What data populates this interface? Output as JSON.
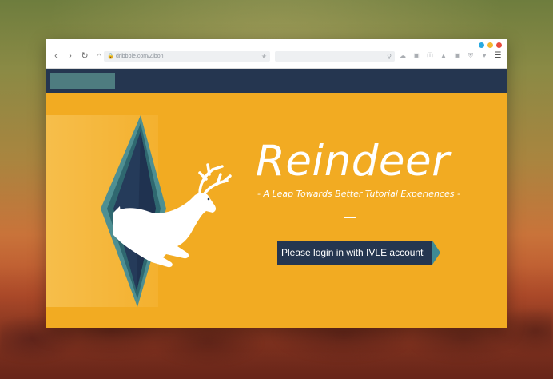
{
  "browser": {
    "url": "dribbble.com/Zibon",
    "nav": {
      "back_icon": "‹",
      "forward_icon": "›",
      "reload_icon": "↻",
      "home_icon": "⌂"
    },
    "window_dots": [
      "#29a9e0",
      "#f5b82e",
      "#e84b3c"
    ],
    "toolbar_icons": [
      "cloud-icon",
      "camera-icon",
      "info-icon",
      "extension-icon",
      "screenshot-icon",
      "shield-icon",
      "heart-icon",
      "menu-icon"
    ]
  },
  "site": {
    "header_color": "#253650",
    "logo_color": "#4e7c80"
  },
  "hero": {
    "title": "Reindeer",
    "subtitle": "- A Leap Towards Better Tutorial Experiences -",
    "login_label": "Please login in with IVLE account",
    "accent": "#f2ab22"
  }
}
